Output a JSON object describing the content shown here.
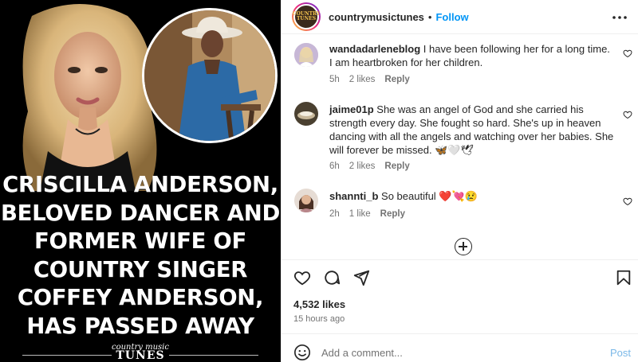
{
  "post_image": {
    "headline_lines": [
      "CRISCILLA ANDERSON,",
      "BELOVED DANCER AND",
      "FORMER WIFE OF",
      "COUNTRY SINGER",
      "COFFEY ANDERSON,",
      "HAS PASSED AWAY"
    ],
    "brand_top": "country music",
    "brand_bottom": "TUNES"
  },
  "header": {
    "avatar_text": "COUNTRY TUNES",
    "username": "countrymusictunes",
    "separator": "•",
    "follow_label": "Follow",
    "more_icon": "more-horizontal-icon"
  },
  "comments": [
    {
      "username": "wandadarleneblog",
      "text": "I have been following her for a long time. I am heartbroken for her children.",
      "time": "5h",
      "likes": "2 likes",
      "reply": "Reply"
    },
    {
      "username": "jaime01p",
      "text": "She was an angel of God and she carried his strength every day. She fought so hard. She's up in heaven dancing with all the angels and watching over her babies. She will forever be missed. 🦋🤍🕊",
      "time": "6h",
      "likes": "2 likes",
      "reply": "Reply"
    },
    {
      "username": "shannti_b",
      "text": "So beautiful ❤️💘😢",
      "time": "2h",
      "likes": "1 like",
      "reply": "Reply"
    }
  ],
  "actions": {
    "like_icon": "heart-icon",
    "comment_icon": "comment-icon",
    "share_icon": "send-icon",
    "save_icon": "bookmark-icon",
    "load_more_icon": "plus-circle-icon"
  },
  "stats": {
    "likes": "4,532 likes",
    "posted": "15 hours ago"
  },
  "add_comment": {
    "placeholder": "Add a comment...",
    "post_label": "Post",
    "emoji_icon": "smiley-icon"
  },
  "colors": {
    "accent": "#0095f6",
    "post_disabled": "#7ab8e8",
    "meta": "#737373",
    "text": "#262626"
  }
}
